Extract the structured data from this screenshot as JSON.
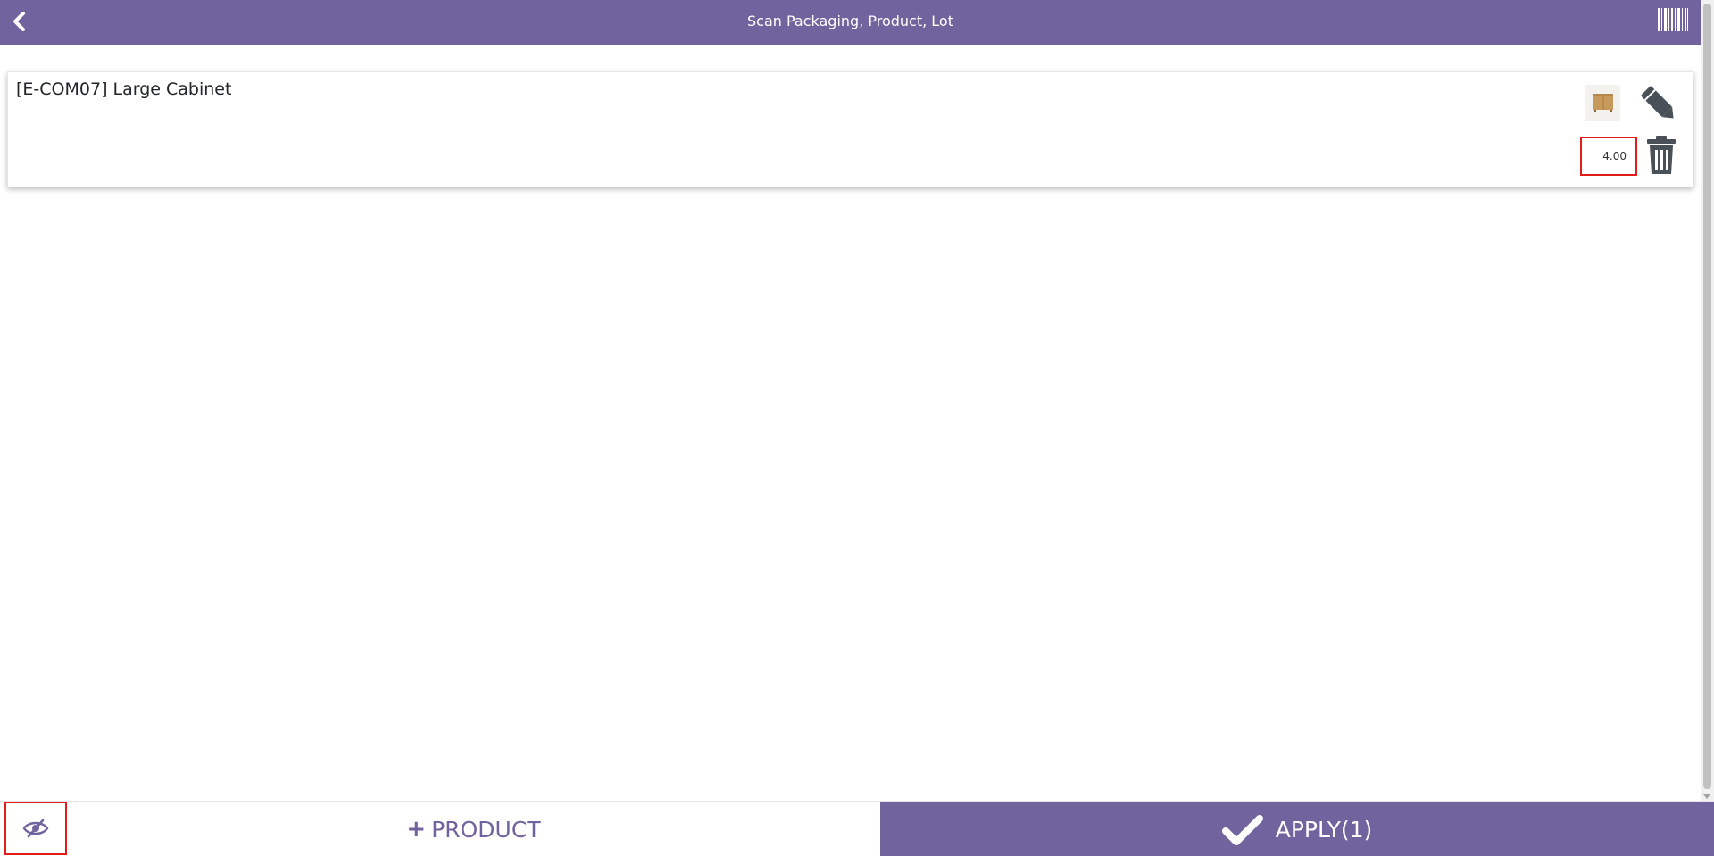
{
  "header": {
    "title": "Scan Packaging, Product, Lot",
    "back_icon": "chevron-left-icon",
    "barcode_icon": "barcode-icon"
  },
  "lines": [
    {
      "product_name": "[E-COM07] Large Cabinet",
      "quantity": "4.00",
      "edit_icon": "pencil-icon",
      "delete_icon": "trash-icon",
      "image": "product-thumbnail"
    }
  ],
  "footer": {
    "toggle_icon": "eye-slash-icon",
    "add_product_plus": "+",
    "add_product_label": "PRODUCT",
    "apply_label": "APPLY(1)",
    "apply_icon": "check-icon"
  },
  "colors": {
    "primary": "#71639e",
    "highlight_border": "#e21b1b",
    "text": "#212529"
  }
}
